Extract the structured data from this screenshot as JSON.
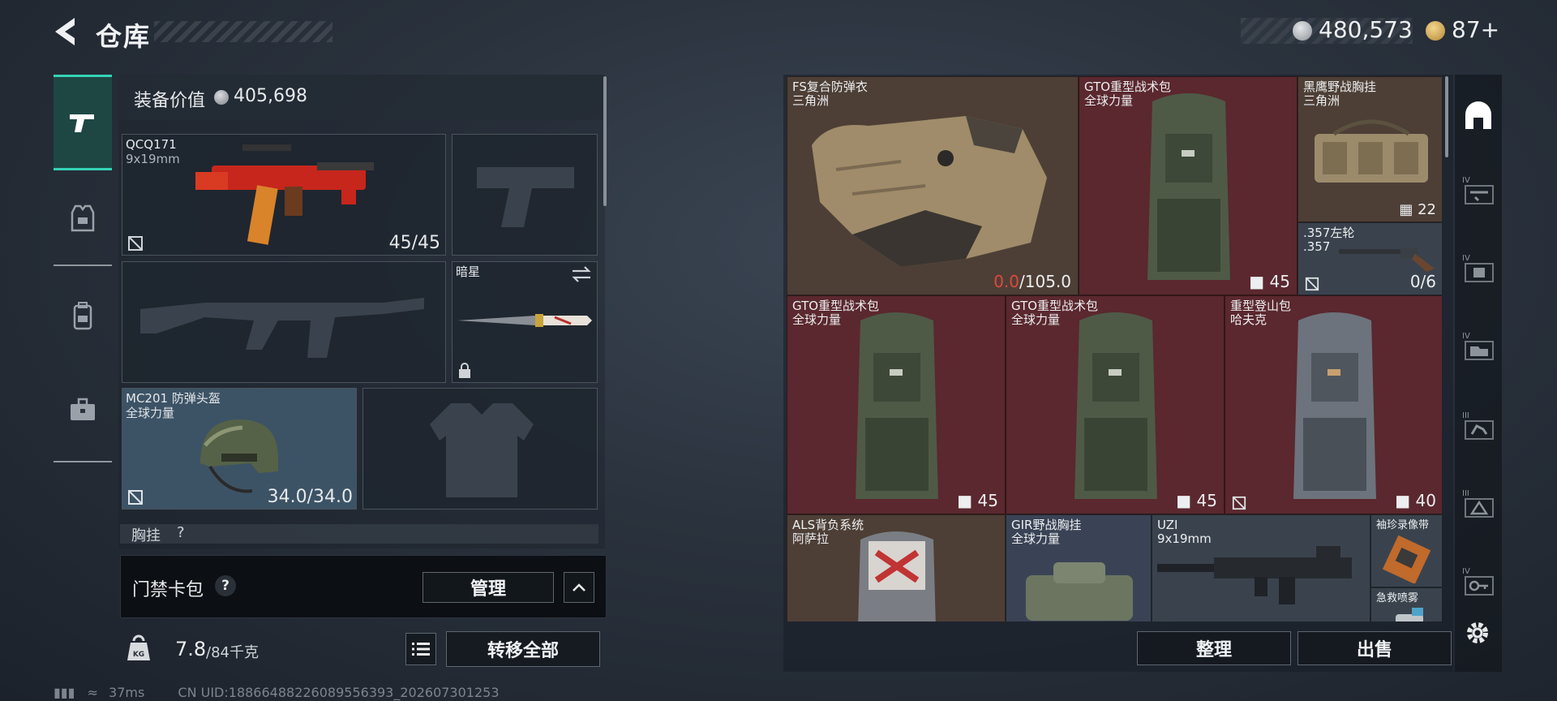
{
  "header": {
    "title": "仓库",
    "currency": {
      "silver": "480,573",
      "gold": "87+"
    }
  },
  "left_nav": {
    "items": [
      {
        "name": "weapons",
        "active": true
      },
      {
        "name": "armor",
        "active": false
      },
      {
        "name": "backpack",
        "active": false
      },
      {
        "name": "toolbox",
        "active": false
      }
    ]
  },
  "equipment": {
    "value_label": "装备价值",
    "value": "405,698",
    "primary_weapon": {
      "name": "QCQ171",
      "ammo": "9x19mm",
      "count": "45/45"
    },
    "melee": {
      "name": "暗星"
    },
    "helmet": {
      "name": "MC201 防弹头盔",
      "brand": "全球力量",
      "durability": "34.0/34.0"
    },
    "chest_peek": "胸挂",
    "chest_peek_help": "?"
  },
  "access_card": {
    "label": "门禁卡包",
    "help": "?",
    "manage_label": "管理",
    "expand_icon": "chevron-up-icon"
  },
  "weight": {
    "current": "7.8",
    "max": "/84千克",
    "icon_label": "KG"
  },
  "buttons": {
    "transfer_all": "转移全部",
    "organize": "整理",
    "sell": "出售"
  },
  "inventory": [
    {
      "name": "FS复合防弹衣",
      "sub": "三角洲",
      "value_red": "0.0",
      "value_rest": "/105.0",
      "type": "armor"
    },
    {
      "name": "GTO重型战术包",
      "sub": "全球力量",
      "count": "45",
      "type": "backpack"
    },
    {
      "name": "黑鹰野战胸挂",
      "sub": "三角洲",
      "count": "22",
      "type": "rig"
    },
    {
      "name": ".357左轮",
      "sub": ".357",
      "count": "0/6",
      "type": "revolver"
    },
    {
      "name": "GTO重型战术包",
      "sub": "全球力量",
      "count": "45",
      "type": "backpack"
    },
    {
      "name": "GTO重型战术包",
      "sub": "全球力量",
      "count": "45",
      "type": "backpack"
    },
    {
      "name": "重型登山包",
      "sub": "哈夫克",
      "count": "40",
      "type": "backpack"
    },
    {
      "name": "ALS背负系统",
      "sub": "阿萨拉",
      "type": "backpack"
    },
    {
      "name": "GIR野战胸挂",
      "sub": "全球力量",
      "type": "rig"
    },
    {
      "name": "UZI",
      "sub": "9x19mm",
      "type": "smg"
    },
    {
      "name": "袖珍录像带",
      "sub": "",
      "type": "tape"
    },
    {
      "name": "急救喷雾",
      "sub": "",
      "type": "spray"
    }
  ],
  "side_filters": [
    {
      "name": "all-filter",
      "tier": ""
    },
    {
      "name": "tier-iv-filter-1",
      "tier": "IV"
    },
    {
      "name": "tier-iv-filter-2",
      "tier": "IV"
    },
    {
      "name": "tier-iv-filter-3",
      "tier": "IV"
    },
    {
      "name": "tier-iii-filter-1",
      "tier": "III"
    },
    {
      "name": "tier-iii-filter-2",
      "tier": "III"
    },
    {
      "name": "tier-iv-filter-4",
      "tier": "IV"
    }
  ],
  "status": {
    "ping": "37ms",
    "uid": "CN UID:18866488226089556393_202607301253"
  },
  "colors": {
    "accent": "#34d3b6",
    "red_value": "#e0483c",
    "rarity_red": "#5a282e",
    "rarity_brown": "#4d3f36"
  }
}
